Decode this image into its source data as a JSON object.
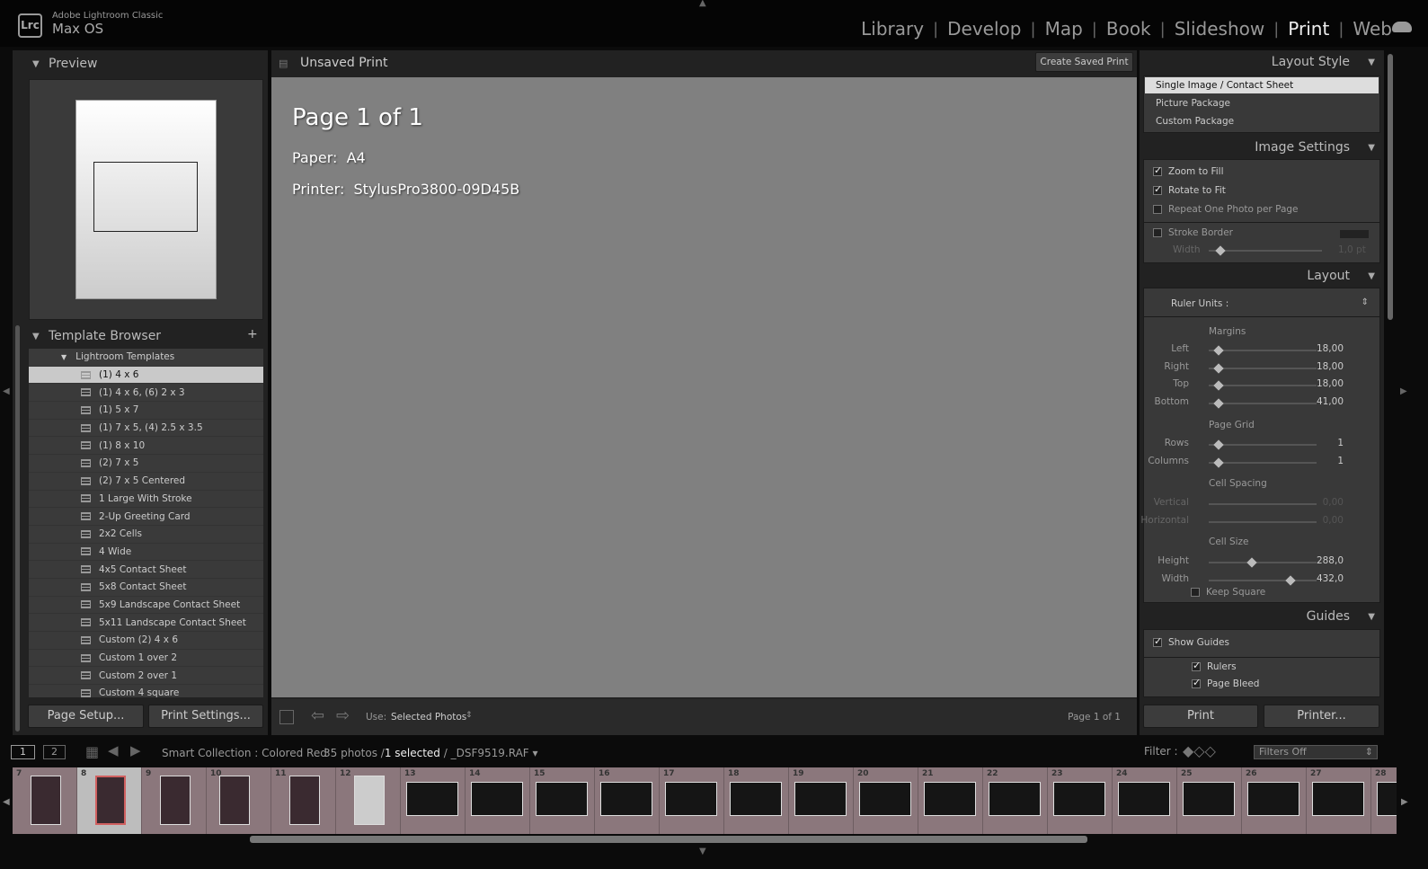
{
  "app": {
    "logo": "Lrc",
    "name": "Adobe Lightroom Classic",
    "catalog": "Max OS"
  },
  "modules": [
    {
      "label": "Library"
    },
    {
      "label": "Develop"
    },
    {
      "label": "Map"
    },
    {
      "label": "Book"
    },
    {
      "label": "Slideshow"
    },
    {
      "label": "Print",
      "active": true
    },
    {
      "label": "Web"
    }
  ],
  "left": {
    "preview_title": "Preview",
    "template_title": "Template Browser",
    "add": "+",
    "folder": "Lightroom Templates",
    "templates": [
      "(1) 4 x 6",
      "(1) 4 x 6, (6) 2 x 3",
      "(1) 5 x 7",
      "(1) 7 x 5, (4) 2.5 x 3.5",
      "(1) 8 x 10",
      "(2) 7 x 5",
      "(2) 7 x 5 Centered",
      "1 Large With Stroke",
      "2-Up Greeting Card",
      "2x2 Cells",
      "4 Wide",
      "4x5 Contact Sheet",
      "5x8 Contact Sheet",
      "5x9 Landscape Contact Sheet",
      "5x11 Landscape Contact Sheet",
      "Custom (2) 4 x 6",
      "Custom 1 over 2",
      "Custom 2 over 1",
      "Custom 4 square"
    ],
    "selected_template": "(1) 4 x 6",
    "page_setup": "Page Setup...",
    "print_settings": "Print Settings..."
  },
  "center": {
    "title": "Unsaved Print",
    "create_saved": "Create Saved Print",
    "page": "Page 1 of 1",
    "paper_label": "Paper:",
    "paper": "A4",
    "printer_label": "Printer:",
    "printer": "StylusPro3800-09D45B",
    "use_label": "Use:",
    "use_value": "Selected Photos",
    "page_count": "Page 1 of 1"
  },
  "right": {
    "layout_style": {
      "title": "Layout Style",
      "options": [
        "Single Image / Contact Sheet",
        "Picture Package",
        "Custom Package"
      ],
      "selected": "Single Image / Contact Sheet"
    },
    "image_settings": {
      "title": "Image Settings",
      "zoom_to_fill": "Zoom to Fill",
      "zoom_to_fill_checked": true,
      "rotate_to_fit": "Rotate to Fit",
      "rotate_to_fit_checked": true,
      "repeat": "Repeat One Photo per Page",
      "repeat_checked": false,
      "stroke": "Stroke Border",
      "stroke_checked": false,
      "width_label": "Width",
      "width_value": "1,0 pt"
    },
    "layout": {
      "title": "Layout",
      "ruler_units": "Ruler Units :",
      "margins": "Margins",
      "margin_rows": [
        {
          "label": "Left",
          "value": "18,00",
          "pos": 0.05
        },
        {
          "label": "Right",
          "value": "18,00",
          "pos": 0.05
        },
        {
          "label": "Top",
          "value": "18,00",
          "pos": 0.05
        },
        {
          "label": "Bottom",
          "value": "41,00",
          "pos": 0.05
        }
      ],
      "page_grid": "Page Grid",
      "grid_rows": [
        {
          "label": "Rows",
          "value": "1",
          "pos": 0.05
        },
        {
          "label": "Columns",
          "value": "1",
          "pos": 0.05
        }
      ],
      "cell_spacing": "Cell Spacing",
      "spacing_rows": [
        {
          "label": "Vertical",
          "value": "0,00"
        },
        {
          "label": "Horizontal",
          "value": "0,00"
        }
      ],
      "cell_size": "Cell Size",
      "size_rows": [
        {
          "label": "Height",
          "value": "288,0",
          "pos": 0.37
        },
        {
          "label": "Width",
          "value": "432,0",
          "pos": 0.74
        }
      ],
      "keep_square": "Keep Square"
    },
    "guides": {
      "title": "Guides",
      "show": "Show Guides",
      "rulers": "Rulers",
      "page_bleed": "Page Bleed"
    },
    "print": "Print",
    "printer_btn": "Printer..."
  },
  "filmstrip": {
    "view1": "1",
    "view2": "2",
    "source": "Smart Collection : Colored Red",
    "count": "35 photos /",
    "selected": "1 selected",
    "file": "/ _DSF9519.RAF",
    "filter_label": "Filter :",
    "filter_value": "Filters Off",
    "numbers": [
      "7",
      "8",
      "9",
      "10",
      "11",
      "12",
      "13",
      "14",
      "15",
      "16",
      "17",
      "18",
      "19",
      "20",
      "21",
      "22",
      "23",
      "24",
      "25",
      "26",
      "27",
      "28"
    ],
    "selected_index": 1,
    "label_color": "#8b777c"
  }
}
